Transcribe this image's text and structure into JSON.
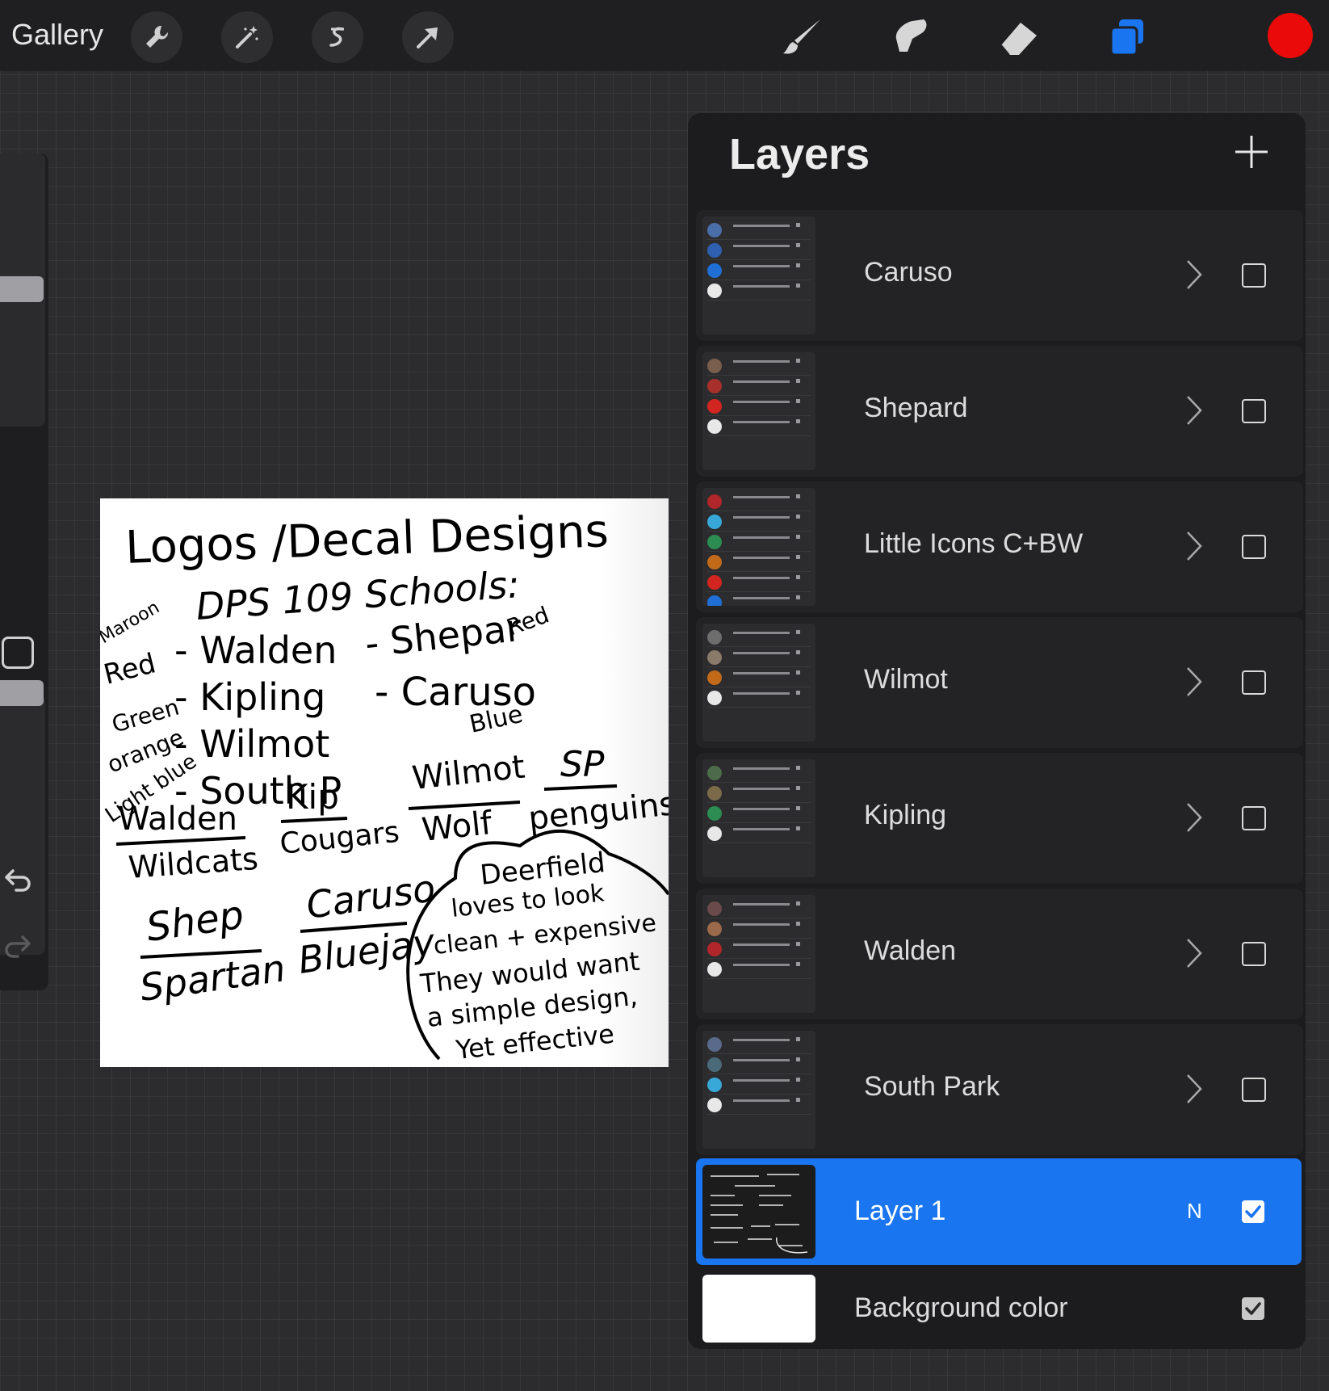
{
  "topbar": {
    "gallery_label": "Gallery",
    "left_tools": [
      "wrench-icon",
      "magic-wand-icon",
      "selection-icon",
      "transform-arrow-icon"
    ],
    "right_tools": [
      "brush-icon",
      "smudge-icon",
      "eraser-icon",
      "layers-icon"
    ],
    "current_color": "#ea0a0a",
    "layers_accent": "#1a75f0"
  },
  "canvas": {
    "lines": {
      "title": "Logos /Decal Designs",
      "subtitle": "DPS 109 Schools:",
      "col1": [
        "- Walden",
        "- Kipling",
        "- Wilmot",
        "- South P"
      ],
      "col2": [
        "- Shepar",
        "- Caruso"
      ],
      "notes_left": [
        "Maroon",
        "Red",
        "Green",
        "orange",
        "Light blue"
      ],
      "notes_right": [
        "Red",
        "Blue"
      ],
      "mascots": [
        "Walden",
        "Wildcats",
        "Kip",
        "Cougars",
        "Wilmot",
        "Wolf",
        "SP",
        "penguins",
        "Shep",
        "Spartan",
        "Caruso",
        "Bluejay"
      ],
      "bubble": [
        "Deerfield",
        "loves to look",
        "clean + expensive",
        "They would want",
        "a simple design,",
        "Yet effective"
      ]
    }
  },
  "layers_panel": {
    "title": "Layers",
    "groups": [
      {
        "name": "Caruso",
        "thumb_colors": [
          "#4a6ea8",
          "#2f5fb0",
          "#1f6fd6",
          "#e8e8e8"
        ]
      },
      {
        "name": "Shepard",
        "thumb_colors": [
          "#7a5f4f",
          "#a8302c",
          "#d2251f",
          "#e8e8e8"
        ]
      },
      {
        "name": "Little Icons C+BW",
        "thumb_colors": [
          "#b1262a",
          "#37a8d8",
          "#2c8c52",
          "#c26a1a",
          "#d2251f",
          "#1f6fd6"
        ]
      },
      {
        "name": "Wilmot",
        "thumb_colors": [
          "#6d6d6d",
          "#8a7a6a",
          "#c26a1a",
          "#e8e8e8"
        ]
      },
      {
        "name": "Kipling",
        "thumb_colors": [
          "#4d6a4a",
          "#7a6a4a",
          "#2c8c52",
          "#e8e8e8"
        ]
      },
      {
        "name": "Walden",
        "thumb_colors": [
          "#6a4a4a",
          "#9a6a4a",
          "#b1262a",
          "#e8e8e8"
        ]
      },
      {
        "name": "South Park",
        "thumb_colors": [
          "#5a6a8a",
          "#4a6a7a",
          "#37a8d8",
          "#e8e8e8"
        ]
      }
    ],
    "active_layer": {
      "name": "Layer 1",
      "blend_mode": "N",
      "visible": true
    },
    "background": {
      "name": "Background color",
      "visible": true
    }
  }
}
